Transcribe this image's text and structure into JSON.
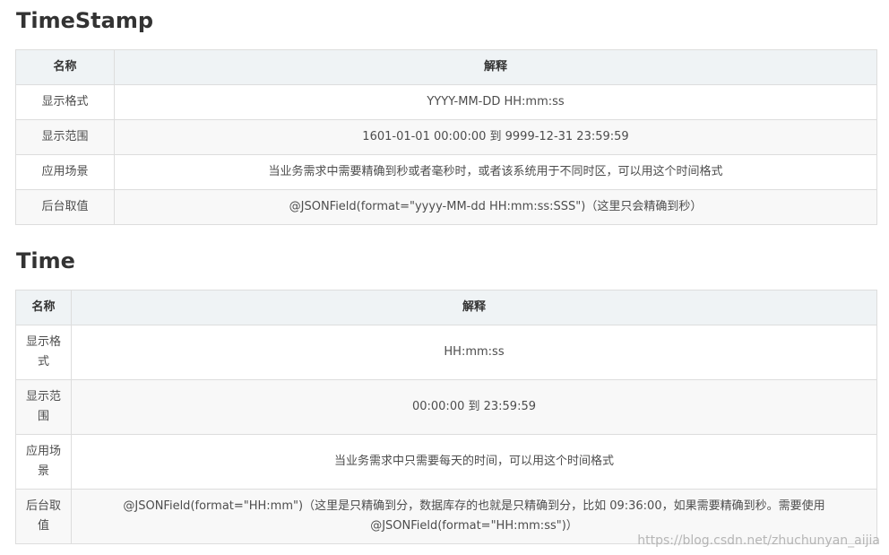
{
  "sections": [
    {
      "title": "TimeStamp",
      "headers": [
        "名称",
        "解释"
      ],
      "rows": [
        {
          "name": "显示格式",
          "desc": "YYYY-MM-DD HH:mm:ss"
        },
        {
          "name": "显示范围",
          "desc": "1601-01-01 00:00:00 到 9999-12-31 23:59:59"
        },
        {
          "name": "应用场景",
          "desc": "当业务需求中需要精确到秒或者毫秒时，或者该系统用于不同时区，可以用这个时间格式"
        },
        {
          "name": "后台取值",
          "desc": "@JSONField(format=\"yyyy-MM-dd HH:mm:ss:SSS\")（这里只会精确到秒）"
        }
      ]
    },
    {
      "title": "Time",
      "headers": [
        "名称",
        "解释"
      ],
      "rows": [
        {
          "name": "显示格式",
          "desc": "HH:mm:ss"
        },
        {
          "name": "显示范围",
          "desc": "00:00:00 到 23:59:59"
        },
        {
          "name": "应用场景",
          "desc": "当业务需求中只需要每天的时间，可以用这个时间格式"
        },
        {
          "name": "后台取值",
          "desc": "@JSONField(format=\"HH:mm\")（这里是只精确到分，数据库存的也就是只精确到分，比如 09:36:00，如果需要精确到秒。需要使用 @JSONField(format=\"HH:mm:ss\")）"
        }
      ]
    }
  ],
  "watermark": "https://blog.csdn.net/zhuchunyan_aijia"
}
